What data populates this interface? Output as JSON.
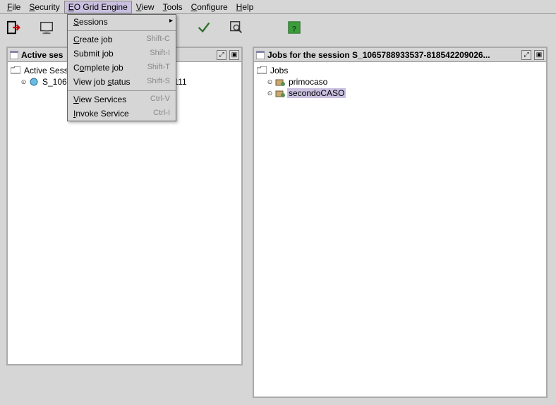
{
  "menubar": {
    "file": "File",
    "security": "Security",
    "eogrid": "EO Grid Engine",
    "view": "View",
    "tools": "Tools",
    "configure": "Configure",
    "help": "Help"
  },
  "dropdown": {
    "sessions": "Sessions",
    "create_job": "Create job",
    "create_job_sc": "Shift-C",
    "submit_job": "Submit job",
    "submit_job_sc": "Shift-I",
    "complete_job": "Complete job",
    "complete_job_sc": "Shift-T",
    "view_status": "View job status",
    "view_status_sc": "Shift-S",
    "view_services": "View Services",
    "view_services_sc": "Ctrl-V",
    "invoke_service": "Invoke Service",
    "invoke_service_sc": "Ctrl-I"
  },
  "left_win": {
    "title": "Active ses",
    "root": "Active Sessi",
    "item1": "S_1065",
    "overflow": "623395111"
  },
  "right_win": {
    "title": "Jobs for the session S_1065788933537-818542209026...",
    "root": "Jobs",
    "item1": "primocaso",
    "item2": "secondoCASO"
  },
  "icons": {
    "exit": "exit-icon",
    "monitor": "monitor-icon",
    "check": "check-icon",
    "zoom": "zoom-icon",
    "help": "help-icon"
  }
}
